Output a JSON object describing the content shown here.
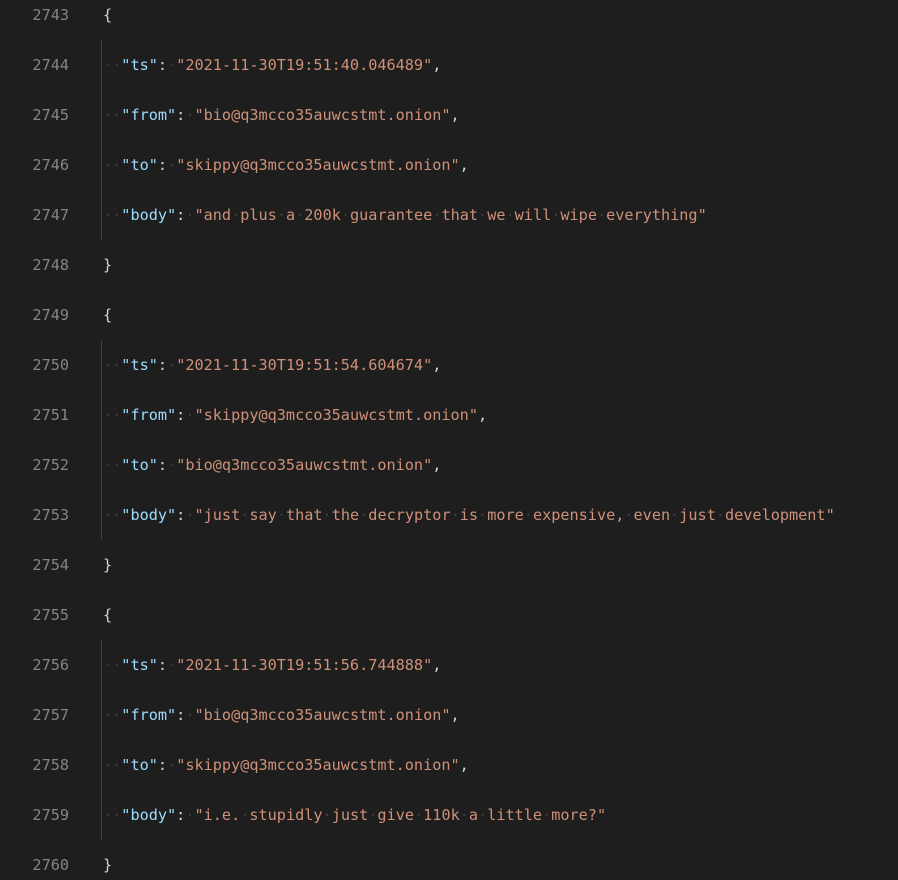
{
  "editor": {
    "lines": [
      {
        "no": "2743",
        "kind": "open",
        "text": "{"
      },
      {
        "no": "2744",
        "kind": "kv",
        "key": "ts",
        "value": "2021-11-30T19:51:40.046489",
        "comma": true
      },
      {
        "no": "2745",
        "kind": "kv",
        "key": "from",
        "value": "bio@q3mcco35auwcstmt.onion",
        "comma": true
      },
      {
        "no": "2746",
        "kind": "kv",
        "key": "to",
        "value": "skippy@q3mcco35auwcstmt.onion",
        "comma": true
      },
      {
        "no": "2747",
        "kind": "kv",
        "key": "body",
        "value": "and plus a 200k guarantee that we will wipe everything",
        "comma": false
      },
      {
        "no": "2748",
        "kind": "close",
        "text": "}"
      },
      {
        "no": "2749",
        "kind": "open",
        "text": "{"
      },
      {
        "no": "2750",
        "kind": "kv",
        "key": "ts",
        "value": "2021-11-30T19:51:54.604674",
        "comma": true
      },
      {
        "no": "2751",
        "kind": "kv",
        "key": "from",
        "value": "skippy@q3mcco35auwcstmt.onion",
        "comma": true
      },
      {
        "no": "2752",
        "kind": "kv",
        "key": "to",
        "value": "bio@q3mcco35auwcstmt.onion",
        "comma": true
      },
      {
        "no": "2753",
        "kind": "kv",
        "key": "body",
        "value": "just say that the decryptor is more expensive, even just development",
        "comma": false
      },
      {
        "no": "2754",
        "kind": "close",
        "text": "}"
      },
      {
        "no": "2755",
        "kind": "open",
        "text": "{"
      },
      {
        "no": "2756",
        "kind": "kv",
        "key": "ts",
        "value": "2021-11-30T19:51:56.744888",
        "comma": true
      },
      {
        "no": "2757",
        "kind": "kv",
        "key": "from",
        "value": "bio@q3mcco35auwcstmt.onion",
        "comma": true
      },
      {
        "no": "2758",
        "kind": "kv",
        "key": "to",
        "value": "skippy@q3mcco35auwcstmt.onion",
        "comma": true
      },
      {
        "no": "2759",
        "kind": "kv",
        "key": "body",
        "value": "i.e. stupidly just give 110k a little more?",
        "comma": false
      },
      {
        "no": "2760",
        "kind": "close",
        "text": "}"
      }
    ]
  },
  "colors": {
    "background": "#1e1e1e",
    "line_number": "#858585",
    "key": "#9cdcfe",
    "string": "#ce9178",
    "punctuation": "#d4d4d4"
  }
}
